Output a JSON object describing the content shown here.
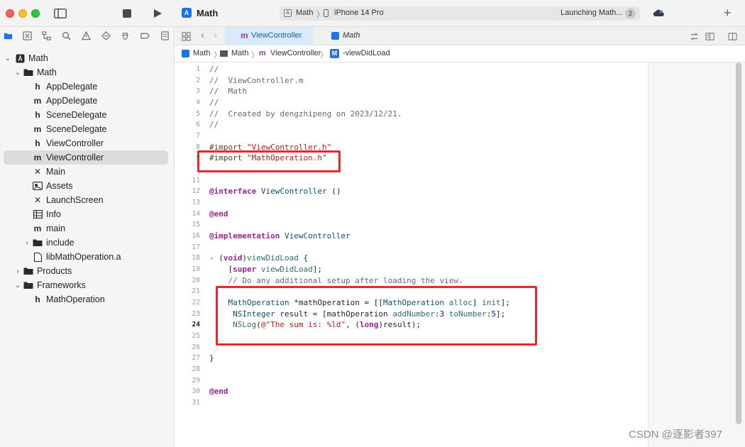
{
  "toolbar": {
    "project": "Math",
    "scheme": "Math",
    "scheme_sep": "〉",
    "device": "iPhone 14 Pro",
    "status": "Launching Math...",
    "status_count": "2",
    "add": "+"
  },
  "navigator": {
    "tree": [
      {
        "label": "Math",
        "icon": "app-project-icon"
      },
      {
        "label": "Math",
        "icon": "folder-icon"
      },
      {
        "label": "AppDelegate",
        "icon": "header-file-icon",
        "glyph": "h"
      },
      {
        "label": "AppDelegate",
        "icon": "objc-file-icon",
        "glyph": "m"
      },
      {
        "label": "SceneDelegate",
        "icon": "header-file-icon",
        "glyph": "h"
      },
      {
        "label": "SceneDelegate",
        "icon": "objc-file-icon",
        "glyph": "m"
      },
      {
        "label": "ViewController",
        "icon": "header-file-icon",
        "glyph": "h"
      },
      {
        "label": "ViewController",
        "icon": "objc-file-icon",
        "glyph": "m"
      },
      {
        "label": "Main",
        "icon": "storyboard-icon",
        "glyph": "✕"
      },
      {
        "label": "Assets",
        "icon": "assets-icon"
      },
      {
        "label": "LaunchScreen",
        "icon": "storyboard-icon",
        "glyph": "✕"
      },
      {
        "label": "Info",
        "icon": "plist-icon"
      },
      {
        "label": "main",
        "icon": "objc-file-icon",
        "glyph": "m"
      },
      {
        "label": "include",
        "icon": "folder-icon"
      },
      {
        "label": "libMathOperation.a",
        "icon": "library-file-icon"
      },
      {
        "label": "Products",
        "icon": "folder-icon"
      },
      {
        "label": "Frameworks",
        "icon": "folder-icon"
      },
      {
        "label": "MathOperation",
        "icon": "header-file-icon",
        "glyph": "h"
      }
    ]
  },
  "editor": {
    "tabs": [
      {
        "label": "ViewController",
        "glyph": "m"
      },
      {
        "label": "Math"
      }
    ],
    "breadcrumb": [
      "Math",
      "Math",
      "ViewController",
      "-viewDidLoad"
    ],
    "breadcrumb_glyph_m": "m",
    "breadcrumb_glyph_M": "M",
    "current_line": "24",
    "line_numbers": [
      "1",
      "2",
      "3",
      "4",
      "5",
      "6",
      "7",
      "8",
      "9",
      "1",
      "11",
      "12",
      "13",
      "14",
      "15",
      "16",
      "17",
      "18",
      "19",
      "20",
      "21",
      "22",
      "23",
      "24",
      "25",
      "26",
      "27",
      "28",
      "29",
      "30",
      "31"
    ],
    "code": {
      "l1": "//",
      "l2": "//  ViewController.m",
      "l3": "//  Math",
      "l4": "//",
      "l5": "//  Created by dengzhipeng on 2023/12/21.",
      "l6": "//",
      "l8_pp": "#import ",
      "l8_str": "\"ViewController.h\"",
      "l9_pp": "#import ",
      "l9_str": "\"MathOperation.h\"",
      "l12_kw": "@interface",
      "l12_ty": " ViewController",
      "l12_rest": " ()",
      "l14_kw": "@end",
      "l16_kw": "@implementation",
      "l16_ty": " ViewController",
      "l18_a": "- (",
      "l18_kw": "void",
      "l18_b": ")",
      "l18_me": "viewDidLoad",
      "l18_c": " {",
      "l19_a": "    [",
      "l19_kw": "super",
      "l19_me": " viewDidLoad",
      "l19_c": "];",
      "l20": "    // Do any additional setup after loading the view.",
      "l22_a": "    ",
      "l22_ty": "MathOperation",
      "l22_b": " *mathOperation = [[",
      "l22_ty2": "MathOperation",
      "l22_me": " alloc",
      "l22_c": "] ",
      "l22_me2": "init",
      "l22_d": "];",
      "l23_a": "     ",
      "l23_ty": "NSInteger",
      "l23_b": " result = [mathOperation ",
      "l23_me": "addNumber",
      "l23_c": ":",
      "l23_n1": "3",
      "l23_me2": " toNumber",
      "l23_d": ":",
      "l23_n2": "5",
      "l23_e": "];",
      "l24_a": "     ",
      "l24_me": "NSLog",
      "l24_b": "(",
      "l24_str": "@\"The sum is: %ld\"",
      "l24_c": ", (",
      "l24_kw": "long",
      "l24_d": ")result);",
      "l27": "}",
      "l30_kw": "@end"
    }
  },
  "watermark": "CSDN @逐影者397",
  "colors": {
    "highlight_box": "#e8292b",
    "selection": "#dcdcdc",
    "active_tab": "#d9ebfb",
    "keyword": "#9b2393",
    "string": "#c41a16",
    "comment": "#5d6c79",
    "type": "#0b4f79"
  }
}
